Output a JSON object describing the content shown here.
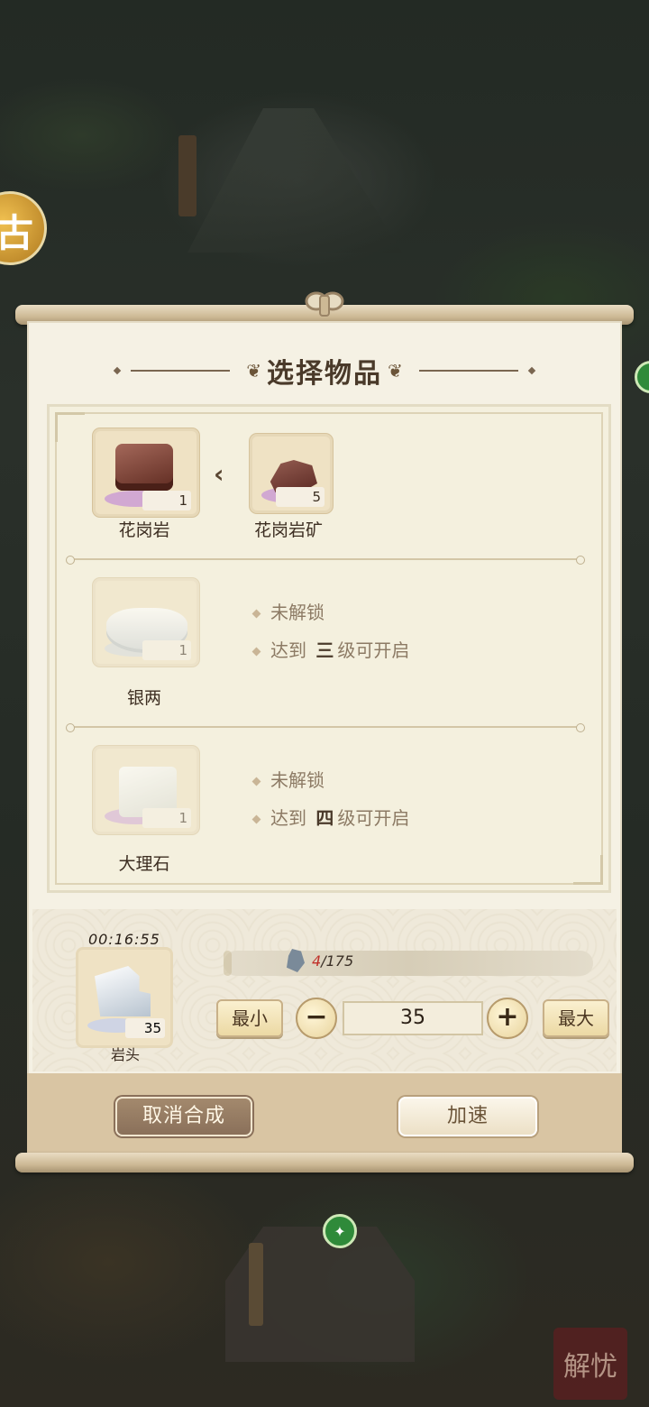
{
  "dialog": {
    "title": "选择物品"
  },
  "items": [
    {
      "name": "花岗岩",
      "count": "1",
      "source": {
        "name": "花岗岩矿",
        "count": "5"
      }
    },
    {
      "name": "银两",
      "count": "1",
      "locked_text": "未解锁",
      "unlock_prefix": "达到",
      "unlock_level": "三",
      "unlock_suffix": "级可开启"
    },
    {
      "name": "大理石",
      "count": "1",
      "locked_text": "未解锁",
      "unlock_prefix": "达到",
      "unlock_level": "四",
      "unlock_suffix": "级可开启"
    }
  ],
  "craft": {
    "timer": "00:16:55",
    "item_name": "岩头",
    "item_count": "35",
    "progress_have": "4",
    "progress_sep": "/",
    "progress_need": "175",
    "progress_fraction": 0.023,
    "min_label": "最小",
    "max_label": "最大",
    "quantity": "35"
  },
  "buttons": {
    "cancel": "取消合成",
    "speed_up": "加速"
  },
  "background": {
    "stamp_text": "解忧",
    "coin_glyph": "古"
  }
}
